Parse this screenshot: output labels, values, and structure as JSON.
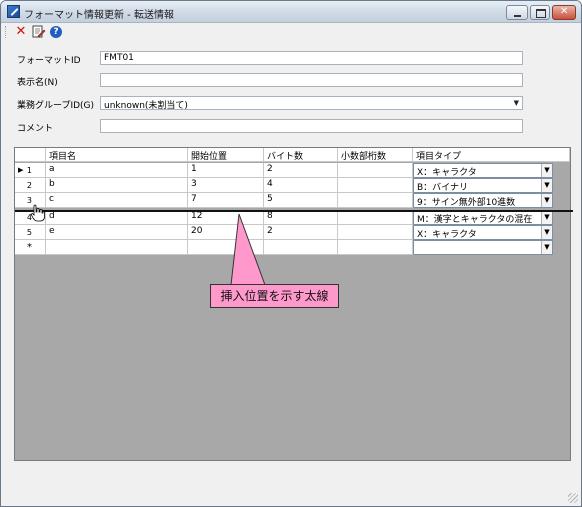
{
  "window": {
    "title": "フォーマット情報更新 - 転送情報"
  },
  "toolbar": {
    "buttons": [
      "close-x-icon",
      "page-edit-icon",
      "help-icon"
    ]
  },
  "form": {
    "format_id": {
      "label": "フォーマットID",
      "value": "FMT01"
    },
    "display_name": {
      "label": "表示名(N)",
      "value": ""
    },
    "business_group": {
      "label": "業務グループID(G)",
      "value": "unknown(未割当て)"
    },
    "comment": {
      "label": "コメント",
      "value": ""
    }
  },
  "grid": {
    "columns": [
      "項目名",
      "開始位置",
      "バイト数",
      "小数部桁数",
      "項目タイプ"
    ],
    "rows": [
      {
        "num": "1",
        "name": "a",
        "start": "1",
        "bytes": "2",
        "decimals": "",
        "type": "X：キャラクタ"
      },
      {
        "num": "2",
        "name": "b",
        "start": "3",
        "bytes": "4",
        "decimals": "",
        "type": "B：バイナリ"
      },
      {
        "num": "3",
        "name": "c",
        "start": "7",
        "bytes": "5",
        "decimals": "",
        "type": "9：サイン無外部10進数"
      },
      {
        "num": "4",
        "name": "d",
        "start": "12",
        "bytes": "8",
        "decimals": "",
        "type": "M：漢字とキャラクタの混在"
      },
      {
        "num": "5",
        "name": "e",
        "start": "20",
        "bytes": "2",
        "decimals": "",
        "type": "X：キャラクタ"
      },
      {
        "num": "*",
        "name": "",
        "start": "",
        "bytes": "",
        "decimals": "",
        "type": ""
      }
    ]
  },
  "callout": {
    "text": "挿入位置を示す太線",
    "color": "#ff99cc"
  }
}
